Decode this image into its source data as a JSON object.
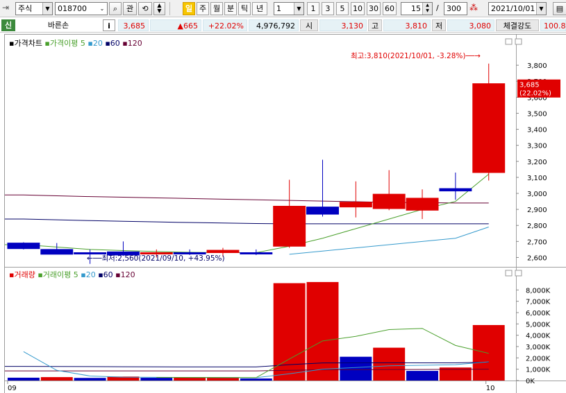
{
  "toolbar": {
    "market_label": "주식",
    "code": "018700",
    "search_label": "관",
    "periods": [
      {
        "label": "일",
        "active": true
      },
      {
        "label": "주",
        "active": false
      },
      {
        "label": "월",
        "active": false
      },
      {
        "label": "분",
        "active": false
      },
      {
        "label": "틱",
        "active": false
      },
      {
        "label": "년",
        "active": false
      }
    ],
    "interval_value": "1",
    "quick_intervals": [
      "1",
      "3",
      "5",
      "10",
      "30",
      "60"
    ],
    "count_value": "15",
    "count_separator": "/",
    "count_max": "300",
    "date_value": "2021/10/01"
  },
  "quote": {
    "tag": "신",
    "name": "바른손",
    "info_label": "i",
    "price": "3,685",
    "change": "▲665",
    "change_rate": "+22.02%",
    "volume": "4,976,792",
    "open_label": "시",
    "open": "3,130",
    "high_label": "고",
    "high": "3,810",
    "low_label": "저",
    "low": "3,080",
    "strength_label": "체결강도",
    "strength": "100.8"
  },
  "colors": {
    "up": "#e00000",
    "down": "#0000c0",
    "ma5": "#4aa02c",
    "ma20": "#3399cc",
    "ma60": "#000066",
    "ma120": "#660033"
  },
  "chart_data": [
    {
      "type": "candlestick",
      "legend": [
        {
          "label": "가격차트",
          "color": "#000000"
        },
        {
          "label": "가격이평 5",
          "color": "#4aa02c"
        },
        {
          "label": "20",
          "color": "#3399cc"
        },
        {
          "label": "60",
          "color": "#000066"
        },
        {
          "label": "120",
          "color": "#660033"
        }
      ],
      "ylim": [
        2550,
        3900
      ],
      "yticks": [
        "3,800",
        "3,700",
        "3,600",
        "3,500",
        "3,400",
        "3,300",
        "3,200",
        "3,100",
        "3,000",
        "2,900",
        "2,800",
        "2,700",
        "2,600"
      ],
      "ytick_values": [
        3800,
        3700,
        3600,
        3500,
        3400,
        3300,
        3200,
        3100,
        3000,
        2900,
        2800,
        2700,
        2600
      ],
      "x_labels": [
        {
          "index": 0,
          "label": "09"
        },
        {
          "index": 14,
          "label": "10"
        }
      ],
      "candles": [
        {
          "o": 2690,
          "h": 2695,
          "l": 2650,
          "c": 2655
        },
        {
          "o": 2650,
          "h": 2690,
          "l": 2620,
          "c": 2620
        },
        {
          "o": 2630,
          "h": 2650,
          "l": 2560,
          "c": 2625
        },
        {
          "o": 2635,
          "h": 2700,
          "l": 2610,
          "c": 2615
        },
        {
          "o": 2625,
          "h": 2650,
          "l": 2600,
          "c": 2630
        },
        {
          "o": 2630,
          "h": 2650,
          "l": 2615,
          "c": 2625
        },
        {
          "o": 2630,
          "h": 2660,
          "l": 2605,
          "c": 2645
        },
        {
          "o": 2630,
          "h": 2650,
          "l": 2615,
          "c": 2625
        },
        {
          "o": 2670,
          "h": 3085,
          "l": 2660,
          "c": 2920
        },
        {
          "o": 2915,
          "h": 3210,
          "l": 2855,
          "c": 2870
        },
        {
          "o": 2915,
          "h": 3075,
          "l": 2850,
          "c": 2945
        },
        {
          "o": 2905,
          "h": 3145,
          "l": 2895,
          "c": 2995
        },
        {
          "o": 2895,
          "h": 3025,
          "l": 2840,
          "c": 2970
        },
        {
          "o": 3030,
          "h": 3130,
          "l": 2960,
          "c": 3015
        },
        {
          "o": 3130,
          "h": 3810,
          "l": 3080,
          "c": 3685
        }
      ],
      "ma5": [
        2680,
        2665,
        2650,
        2643,
        2637,
        2632,
        2630,
        2630,
        2670,
        2720,
        2780,
        2840,
        2900,
        2950,
        3120
      ],
      "ma20": [
        null,
        null,
        null,
        null,
        null,
        null,
        null,
        null,
        2620,
        2640,
        2660,
        2680,
        2700,
        2720,
        2790
      ],
      "ma60": [
        2840,
        2835,
        2830,
        2826,
        2822,
        2818,
        2815,
        2812,
        2810,
        2810,
        2810,
        2810,
        2810,
        2810,
        2810
      ],
      "ma120": [
        2990,
        2985,
        2980,
        2976,
        2972,
        2968,
        2964,
        2960,
        2956,
        2952,
        2948,
        2944,
        2942,
        2940,
        2940
      ],
      "annotations": [
        {
          "text": "최고:3,810(2021/10/01, -3.28%)──→",
          "color": "#e00000"
        },
        {
          "text": "←──최저:2,560(2021/09/10, +43.95%)",
          "color": "#000066"
        }
      ],
      "price_tag": {
        "value": "3,685",
        "rate": "(22.02%)"
      }
    },
    {
      "type": "bar",
      "legend": [
        {
          "label": "거래량",
          "color": "#e00000"
        },
        {
          "label": "거래이평 5",
          "color": "#4aa02c"
        },
        {
          "label": "20",
          "color": "#3399cc"
        },
        {
          "label": "60",
          "color": "#000066"
        },
        {
          "label": "120",
          "color": "#660033"
        }
      ],
      "ylim": [
        0,
        9000
      ],
      "yticks": [
        "8,000K",
        "7,000K",
        "6,000K",
        "5,000K",
        "4,000K",
        "3,000K",
        "2,000K",
        "1,000K",
        "0K"
      ],
      "ytick_values": [
        8000,
        7000,
        6000,
        5000,
        4000,
        3000,
        2000,
        1000,
        0
      ],
      "volumes": [
        250,
        300,
        230,
        350,
        240,
        260,
        250,
        180,
        8600,
        8700,
        2100,
        2900,
        850,
        1150,
        4900
      ],
      "up": [
        false,
        true,
        false,
        true,
        false,
        true,
        true,
        false,
        true,
        true,
        false,
        true,
        false,
        true,
        true
      ],
      "ma5": [
        null,
        null,
        null,
        null,
        275,
        276,
        266,
        258,
        1900,
        3500,
        3900,
        4500,
        4600,
        3100,
        2400
      ],
      "ma20": [
        2550,
        900,
        400,
        300,
        280,
        270,
        260,
        250,
        600,
        1000,
        1150,
        1300,
        1350,
        1400,
        1650
      ],
      "ma60": [
        1250,
        1240,
        1230,
        1220,
        1210,
        1200,
        1200,
        1200,
        1400,
        1550,
        1560,
        1570,
        1560,
        1560,
        1620
      ],
      "ma120": [
        850,
        850,
        850,
        850,
        850,
        850,
        850,
        850,
        900,
        950,
        960,
        970,
        980,
        990,
        1000
      ]
    }
  ]
}
